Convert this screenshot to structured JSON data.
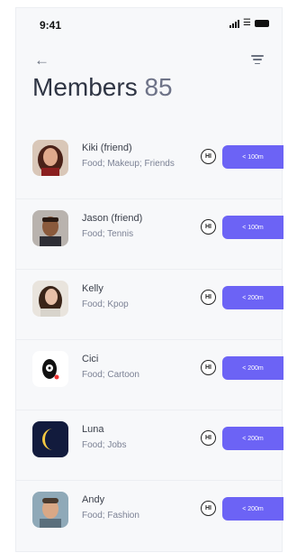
{
  "status_bar": {
    "time": "9:41"
  },
  "header": {
    "title": "Members",
    "count": "85"
  },
  "members": [
    {
      "name": "Kiki (friend)",
      "tags": "Food; Makeup; Friends",
      "greeting": "HI",
      "distance": "< 100m",
      "avatar": "kiki-avatar"
    },
    {
      "name": "Jason (friend)",
      "tags": "Food; Tennis",
      "greeting": "HI",
      "distance": "< 100m",
      "avatar": "jason-avatar"
    },
    {
      "name": "Kelly",
      "tags": "Food; Kpop",
      "greeting": "HI",
      "distance": "< 200m",
      "avatar": "kelly-avatar"
    },
    {
      "name": "Cici",
      "tags": "Food; Cartoon",
      "greeting": "HI",
      "distance": "< 200m",
      "avatar": "cici-avatar"
    },
    {
      "name": "Luna",
      "tags": "Food; Jobs",
      "greeting": "HI",
      "distance": "< 200m",
      "avatar": "luna-avatar"
    },
    {
      "name": "Andy",
      "tags": "Food; Fashion",
      "greeting": "HI",
      "distance": "< 200m",
      "avatar": "andy-avatar"
    }
  ],
  "colors": {
    "accent": "#6c63f5",
    "background": "#f7f8fa"
  }
}
